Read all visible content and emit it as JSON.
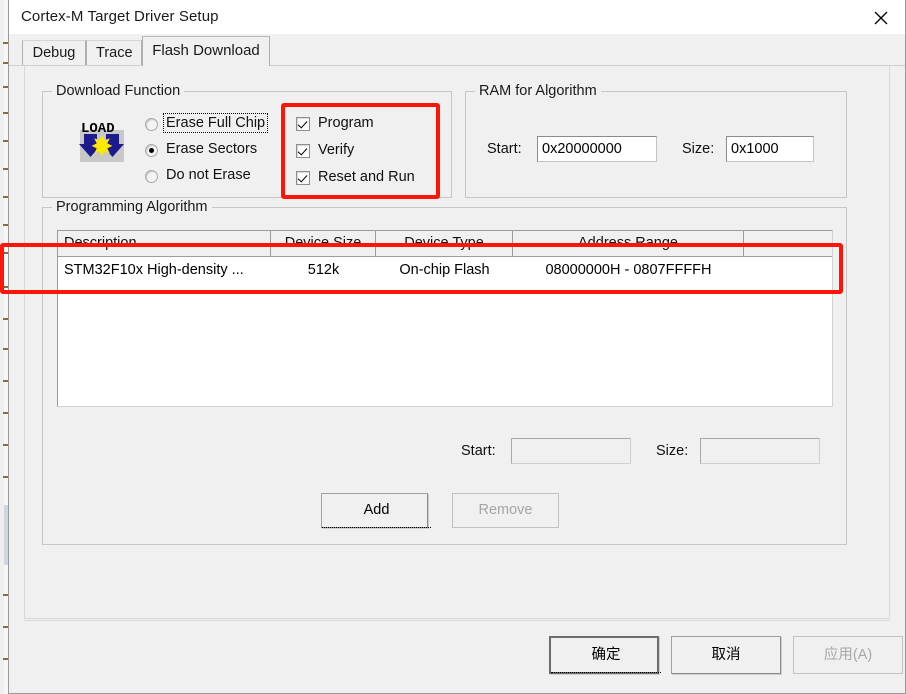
{
  "window": {
    "title": "Cortex-M Target Driver Setup",
    "close_icon": "close-icon"
  },
  "tabs": [
    {
      "label": "Debug",
      "active": false
    },
    {
      "label": "Trace",
      "active": false
    },
    {
      "label": "Flash Download",
      "active": true
    }
  ],
  "download_function": {
    "group_title": "Download Function",
    "icon": "load-flash-icon",
    "icon_text": "LOAD",
    "radios": [
      {
        "label": "Erase Full Chip",
        "selected": false,
        "focused": true
      },
      {
        "label": "Erase Sectors",
        "selected": true,
        "focused": false
      },
      {
        "label": "Do not Erase",
        "selected": false,
        "focused": false
      }
    ],
    "checkboxes": [
      {
        "label": "Program",
        "checked": true
      },
      {
        "label": "Verify",
        "checked": true
      },
      {
        "label": "Reset and Run",
        "checked": true
      }
    ]
  },
  "ram_for_algorithm": {
    "group_title": "RAM for Algorithm",
    "start_label": "Start:",
    "start_value": "0x20000000",
    "size_label": "Size:",
    "size_value": "0x1000"
  },
  "programming_algorithm": {
    "group_title": "Programming Algorithm",
    "columns": [
      "Description",
      "Device Size",
      "Device Type",
      "Address Range",
      ""
    ],
    "rows": [
      {
        "description": "STM32F10x High-density ...",
        "device_size": "512k",
        "device_type": "On-chip Flash",
        "address_range": "08000000H - 0807FFFFH",
        "extra": ""
      }
    ],
    "start_label": "Start:",
    "start_value": "",
    "size_label": "Size:",
    "size_value": "",
    "add_button": "Add",
    "remove_button": "Remove",
    "remove_disabled": true
  },
  "footer": {
    "ok_button": "确定",
    "cancel_button": "取消",
    "apply_button": "应用(A)",
    "apply_disabled": true
  },
  "annotations": {
    "accent_color": "#fb1608",
    "highlight_checkboxes": "download-function-checkboxes",
    "highlight_table": "programming-algorithm-table-row"
  }
}
